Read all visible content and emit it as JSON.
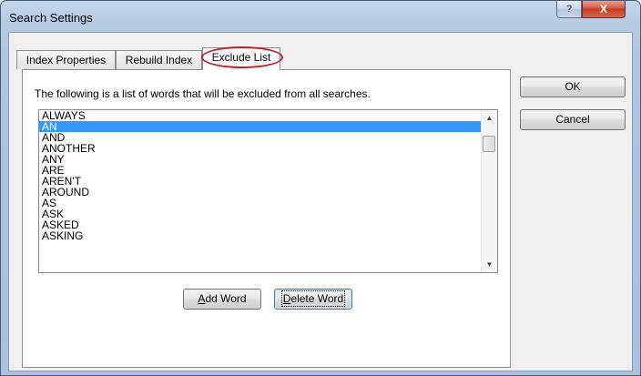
{
  "window": {
    "title": "Search Settings",
    "help_label": "?",
    "close_label": "X"
  },
  "tabs": [
    {
      "label": "Index Properties",
      "active": false
    },
    {
      "label": "Rebuild Index",
      "active": false
    },
    {
      "label": "Exclude List",
      "active": true
    }
  ],
  "exclude_list": {
    "description": "The following is a list of words that will be excluded from all searches.",
    "selected_word": "AN",
    "words": [
      "ALWAYS",
      "AN",
      "AND",
      "ANOTHER",
      "ANY",
      "ARE",
      "AREN'T",
      "AROUND",
      "AS",
      "ASK",
      "ASKED",
      "ASKING"
    ],
    "scroll_up_icon": "▲",
    "scroll_down_icon": "▼"
  },
  "buttons": {
    "ok": "OK",
    "cancel": "Cancel",
    "add_word_mnemonic": "A",
    "add_word_rest": "dd Word",
    "delete_word_mnemonic": "D",
    "delete_word_rest": "elete Word"
  },
  "colors": {
    "selection": "#3399ff",
    "highlight_oval": "#c0202a",
    "close_button": "#c03a22"
  }
}
